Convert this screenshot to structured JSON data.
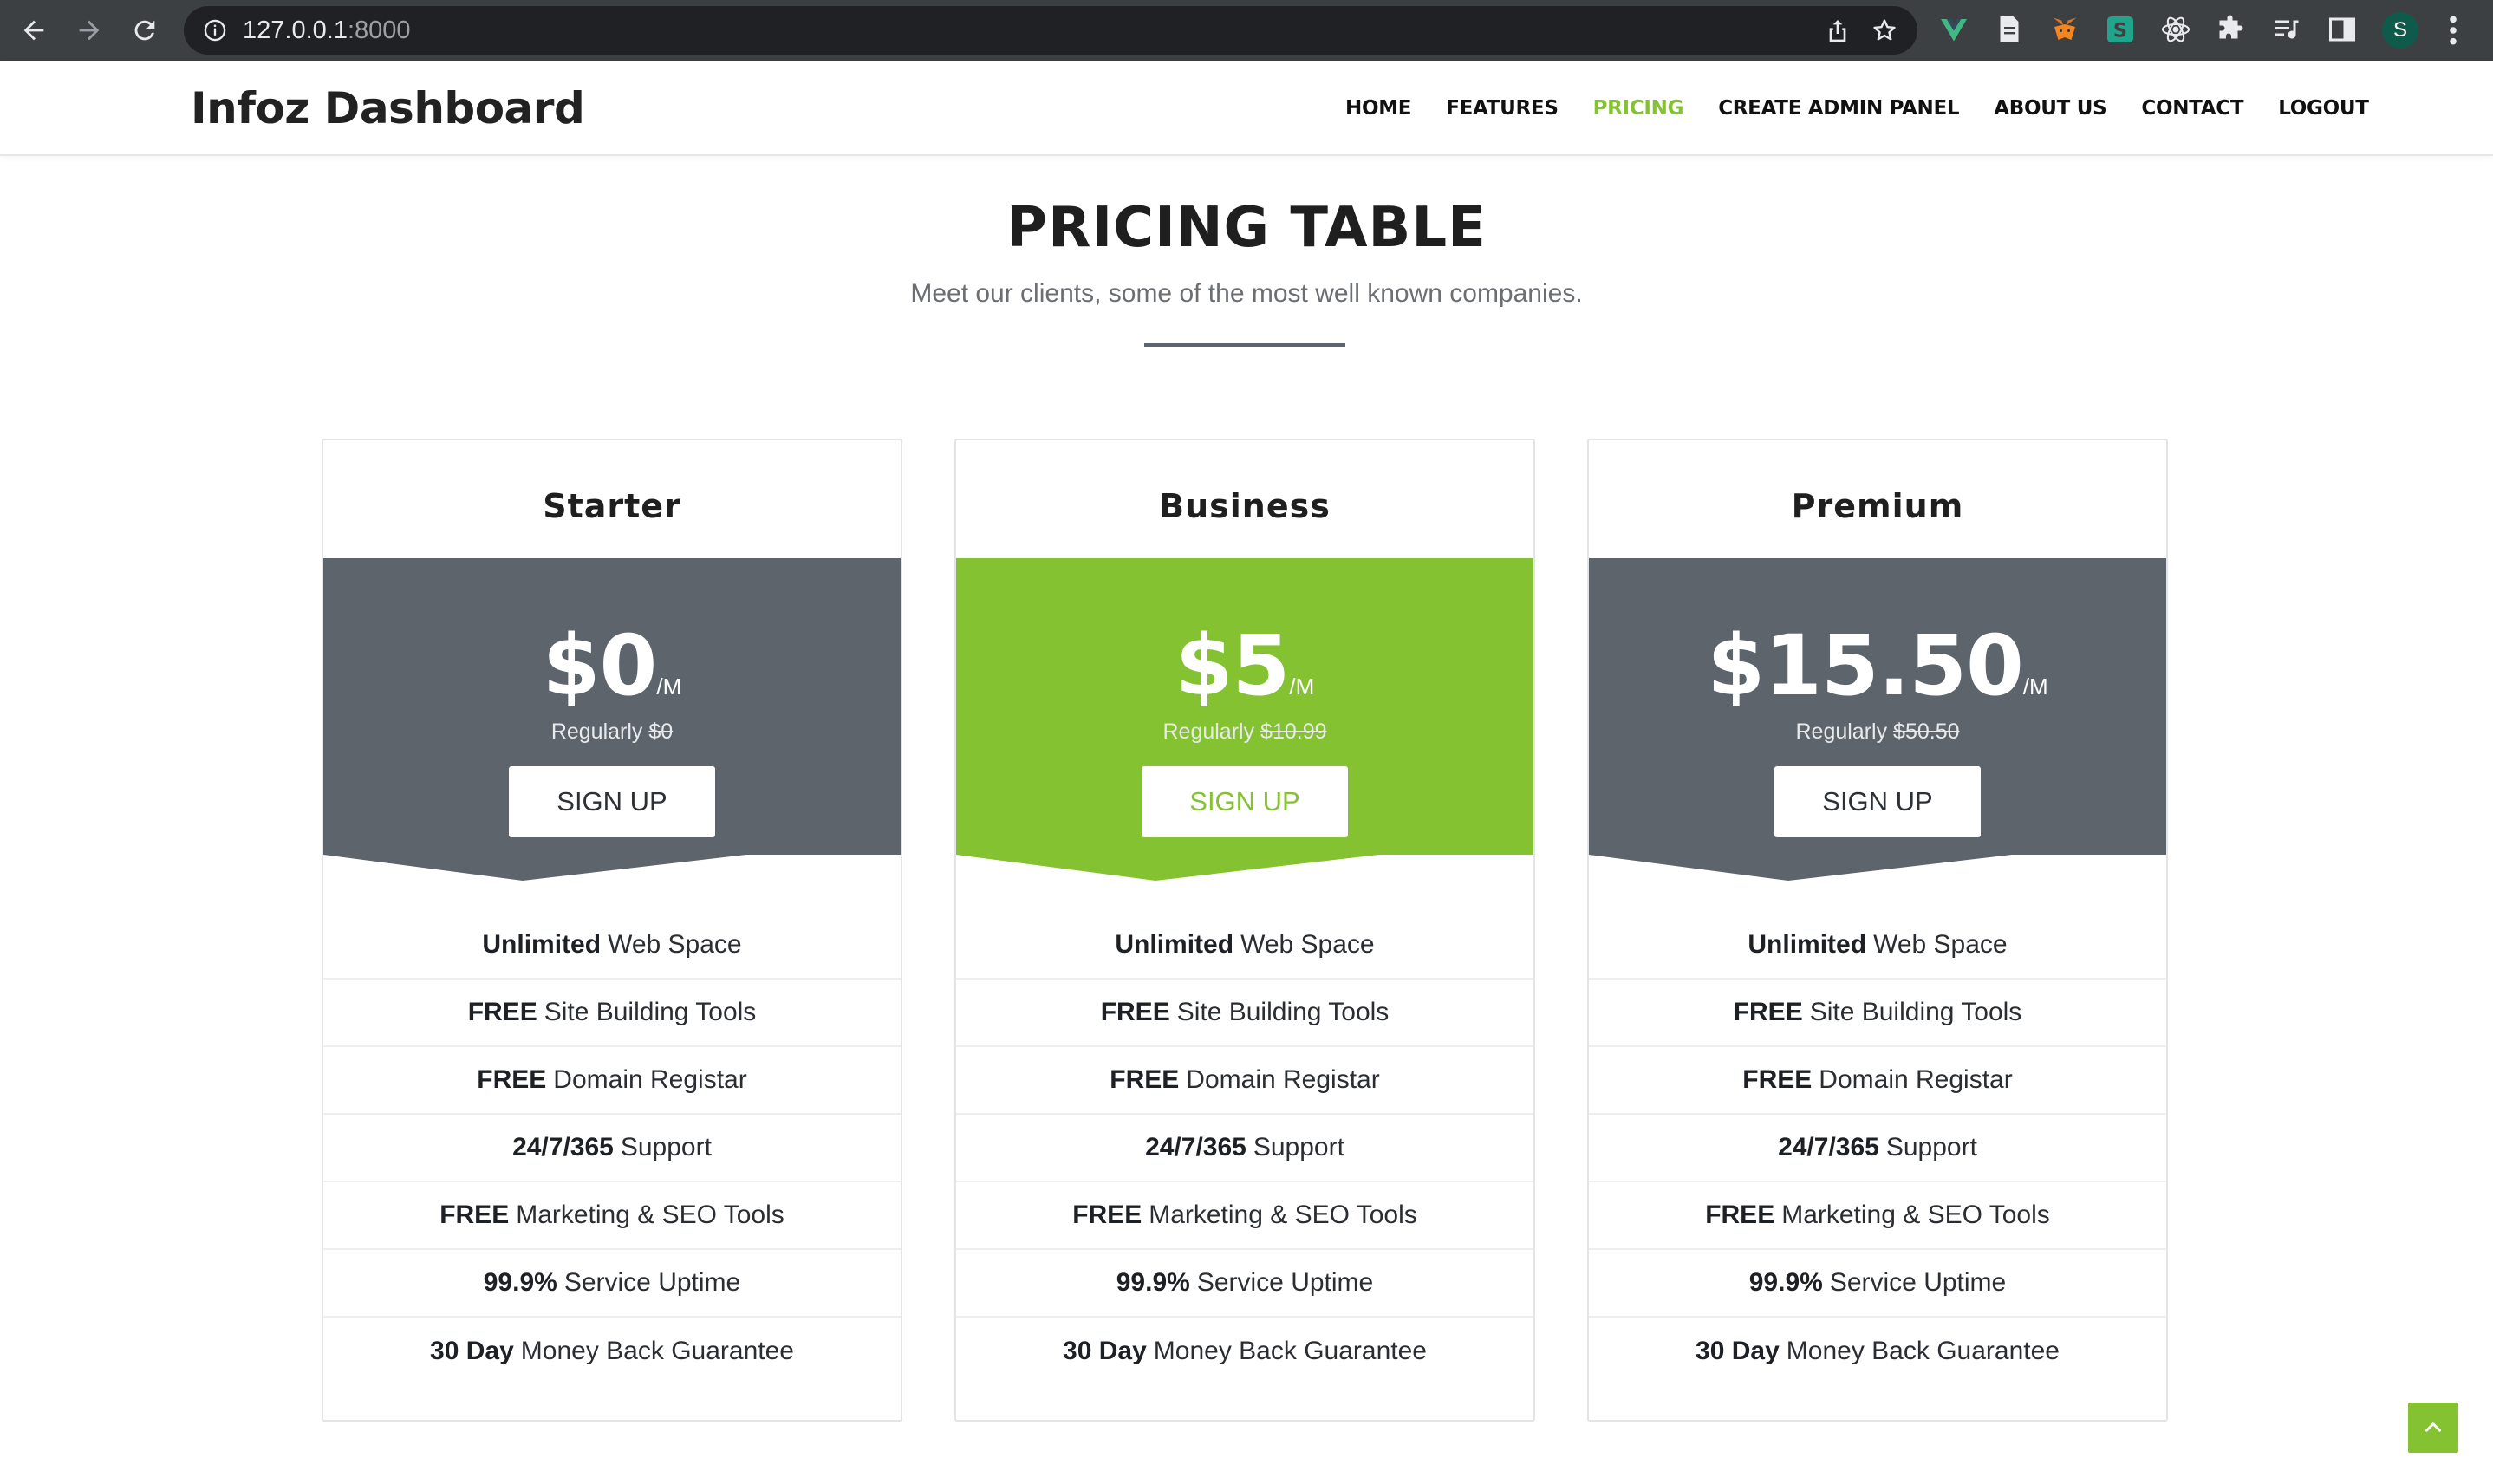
{
  "browser": {
    "url_host": "127.0.0.1",
    "url_port": ":8000",
    "profile_initial": "S",
    "icons": [
      "back-icon",
      "forward-icon",
      "reload-icon",
      "info-icon",
      "share-icon",
      "bookmark-star-icon",
      "vue-devtools-icon",
      "document-extension-icon",
      "metamask-fox-icon",
      "s-extension-icon",
      "react-devtools-icon",
      "extensions-puzzle-icon",
      "media-playlist-icon",
      "side-panel-icon",
      "menu-kebab-icon"
    ]
  },
  "header": {
    "brand": "Infoz Dashboard",
    "menu": [
      {
        "label": "HOME",
        "active": false
      },
      {
        "label": "FEATURES",
        "active": false
      },
      {
        "label": "PRICING",
        "active": true
      },
      {
        "label": "CREATE ADMIN PANEL",
        "active": false
      },
      {
        "label": "ABOUT US",
        "active": false
      },
      {
        "label": "CONTACT",
        "active": false
      },
      {
        "label": "LOGOUT",
        "active": false
      }
    ]
  },
  "section": {
    "title": "PRICING TABLE",
    "subtitle": "Meet our clients, some of the most well known companies."
  },
  "plans": [
    {
      "name": "Starter",
      "price": "$0",
      "per": "/M",
      "regular_label": "Regularly",
      "regular_price": "$0",
      "button": "SIGN UP",
      "highlight": false,
      "features": [
        {
          "bold": "Unlimited",
          "text": "Web Space"
        },
        {
          "bold": "FREE",
          "text": "Site Building Tools"
        },
        {
          "bold": "FREE",
          "text": "Domain Registar"
        },
        {
          "bold": "24/7/365",
          "text": "Support"
        },
        {
          "bold": "FREE",
          "text": "Marketing & SEO Tools"
        },
        {
          "bold": "99.9%",
          "text": "Service Uptime"
        },
        {
          "bold": "30 Day",
          "text": "Money Back Guarantee"
        }
      ]
    },
    {
      "name": "Business",
      "price": "$5",
      "per": "/M",
      "regular_label": "Regularly",
      "regular_price": "$10.99",
      "button": "SIGN UP",
      "highlight": true,
      "features": [
        {
          "bold": "Unlimited",
          "text": "Web Space"
        },
        {
          "bold": "FREE",
          "text": "Site Building Tools"
        },
        {
          "bold": "FREE",
          "text": "Domain Registar"
        },
        {
          "bold": "24/7/365",
          "text": "Support"
        },
        {
          "bold": "FREE",
          "text": "Marketing & SEO Tools"
        },
        {
          "bold": "99.9%",
          "text": "Service Uptime"
        },
        {
          "bold": "30 Day",
          "text": "Money Back Guarantee"
        }
      ]
    },
    {
      "name": "Premium",
      "price": "$15.50",
      "per": "/M",
      "regular_label": "Regularly",
      "regular_price": "$50.50",
      "button": "SIGN UP",
      "highlight": false,
      "features": [
        {
          "bold": "Unlimited",
          "text": "Web Space"
        },
        {
          "bold": "FREE",
          "text": "Site Building Tools"
        },
        {
          "bold": "FREE",
          "text": "Domain Registar"
        },
        {
          "bold": "24/7/365",
          "text": "Support"
        },
        {
          "bold": "FREE",
          "text": "Marketing & SEO Tools"
        },
        {
          "bold": "99.9%",
          "text": "Service Uptime"
        },
        {
          "bold": "30 Day",
          "text": "Money Back Guarantee"
        }
      ]
    }
  ],
  "colors": {
    "accent_green": "#85c232",
    "band_gray": "#5d646c",
    "chrome_dark": "#3c4043"
  }
}
